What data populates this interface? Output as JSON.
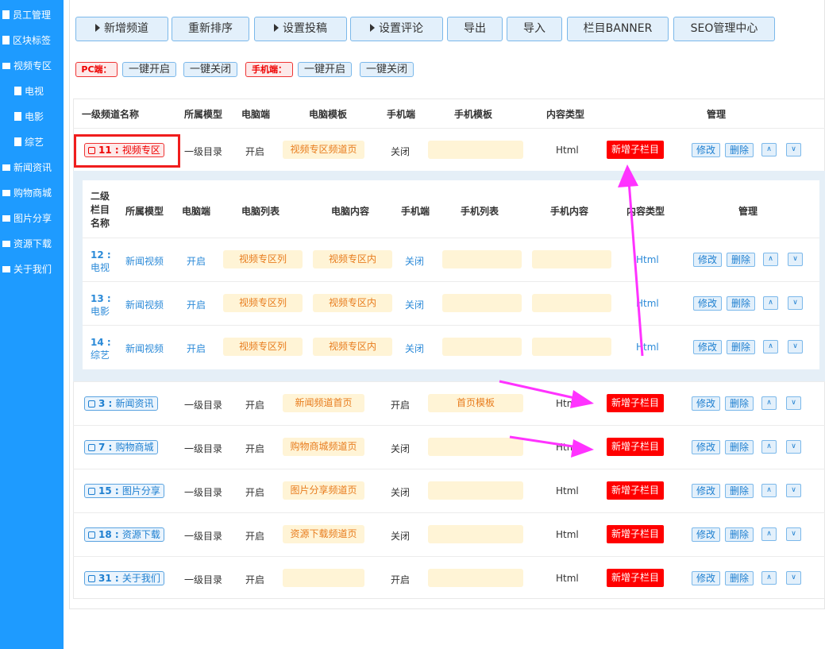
{
  "sidebar": {
    "items": [
      {
        "label": "员工管理",
        "icon": "document-icon"
      },
      {
        "label": "区块标签",
        "icon": "document-icon"
      },
      {
        "label": "视频专区",
        "icon": "folder-icon"
      },
      {
        "label": "电视",
        "icon": "document-icon"
      },
      {
        "label": "电影",
        "icon": "document-icon"
      },
      {
        "label": "综艺",
        "icon": "document-icon"
      },
      {
        "label": "新闻资讯",
        "icon": "folder-icon"
      },
      {
        "label": "购物商城",
        "icon": "folder-icon"
      },
      {
        "label": "图片分享",
        "icon": "folder-icon"
      },
      {
        "label": "资源下载",
        "icon": "folder-icon"
      },
      {
        "label": "关于我们",
        "icon": "folder-icon"
      }
    ]
  },
  "toolbar": {
    "add_channel": "新增频道",
    "reorder": "重新排序",
    "submit_settings": "设置投稿",
    "comment_settings": "设置评论",
    "export": "导出",
    "import": "导入",
    "banner": "栏目BANNER",
    "seo": "SEO管理中心"
  },
  "toggles": {
    "pc_label": "PC端：",
    "pc_on": "一键开启",
    "pc_off": "一键关闭",
    "mobile_label": "手机端：",
    "mobile_on": "一键开启",
    "mobile_off": "一键关闭"
  },
  "table": {
    "headers": {
      "name": "一级频道名称",
      "model": "所属模型",
      "pc": "电脑端",
      "pc_tpl": "电脑模板",
      "mobile": "手机端",
      "mobile_tpl": "手机模板",
      "content_type": "内容类型",
      "manage": "管理"
    },
    "action_add_sub": "新增子栏目",
    "action_edit": "修改",
    "action_delete": "删除",
    "action_up": "∧",
    "action_down": "∨",
    "rows": [
      {
        "id": "11",
        "name": "视频专区",
        "model": "一级目录",
        "pc": "开启",
        "pc_tpl": "视频专区频道页",
        "mobile": "关闭",
        "mobile_tpl": "",
        "type": "Html"
      },
      {
        "id": "3",
        "name": "新闻资讯",
        "model": "一级目录",
        "pc": "开启",
        "pc_tpl": "新闻频道首页",
        "mobile": "开启",
        "mobile_tpl": "首页模板",
        "type": "Html"
      },
      {
        "id": "7",
        "name": "购物商城",
        "model": "一级目录",
        "pc": "开启",
        "pc_tpl": "购物商城频道页",
        "mobile": "关闭",
        "mobile_tpl": "",
        "type": "Html"
      },
      {
        "id": "15",
        "name": "图片分享",
        "model": "一级目录",
        "pc": "开启",
        "pc_tpl": "图片分享频道页",
        "mobile": "关闭",
        "mobile_tpl": "",
        "type": "Html"
      },
      {
        "id": "18",
        "name": "资源下载",
        "model": "一级目录",
        "pc": "开启",
        "pc_tpl": "资源下载频道页",
        "mobile": "关闭",
        "mobile_tpl": "",
        "type": "Html"
      },
      {
        "id": "31",
        "name": "关于我们",
        "model": "一级目录",
        "pc": "开启",
        "pc_tpl": "",
        "mobile": "开启",
        "mobile_tpl": "",
        "type": "Html"
      }
    ]
  },
  "subtable": {
    "headers": {
      "name_line1": "二级",
      "name_line2": "栏目",
      "name_line3": "名称",
      "model": "所属模型",
      "pc": "电脑端",
      "pc_list": "电脑列表",
      "pc_content": "电脑内容",
      "mobile": "手机端",
      "mobile_list": "手机列表",
      "mobile_content": "手机内容",
      "content_type": "内容类型",
      "manage": "管理"
    },
    "rows": [
      {
        "id": "12 :",
        "name": "电视",
        "model": "新闻视频",
        "pc": "开启",
        "pc_list": "视频专区列",
        "pc_content": "视频专区内",
        "mobile": "关闭",
        "mobile_list": "",
        "mobile_content": "",
        "type": "Html"
      },
      {
        "id": "13 :",
        "name": "电影",
        "model": "新闻视频",
        "pc": "开启",
        "pc_list": "视频专区列",
        "pc_content": "视频专区内",
        "mobile": "关闭",
        "mobile_list": "",
        "mobile_content": "",
        "type": "Html"
      },
      {
        "id": "14 :",
        "name": "综艺",
        "model": "新闻视频",
        "pc": "开启",
        "pc_list": "视频专区列",
        "pc_content": "视频专区内",
        "mobile": "关闭",
        "mobile_list": "",
        "mobile_content": "",
        "type": "Html"
      }
    ]
  },
  "colors": {
    "sidebar": "#1e9bff",
    "add_sub": "#ff0000",
    "annotation_arrow": "#ff33ff",
    "highlight_box": "#f01d1d"
  }
}
